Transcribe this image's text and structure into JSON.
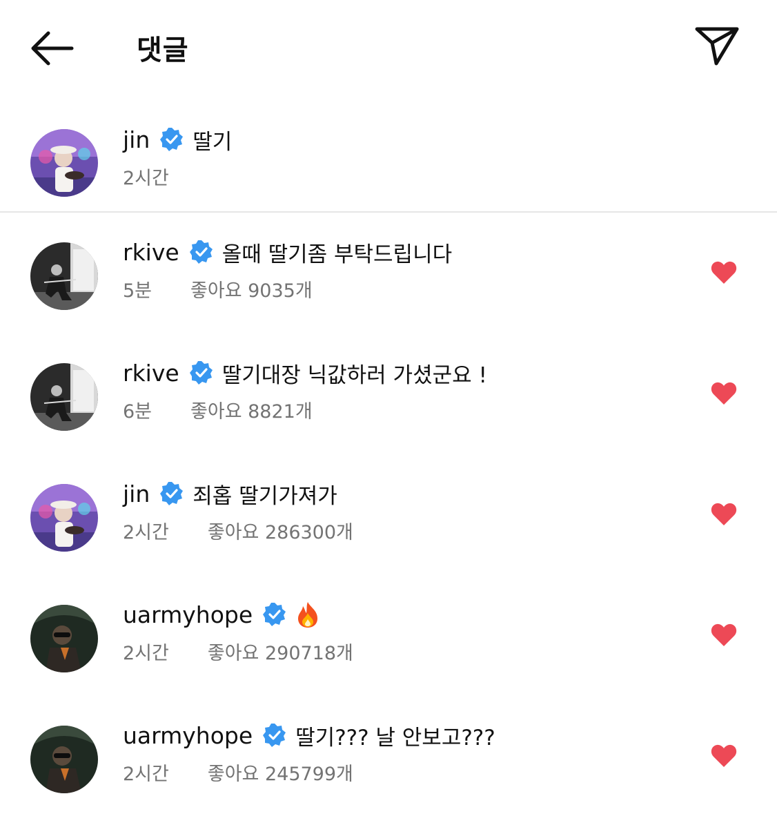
{
  "header": {
    "title": "댓글",
    "back_icon": "arrow-left-icon",
    "send_icon": "send-icon"
  },
  "caption": {
    "username": "jin",
    "text": "딸기",
    "time": "2시간"
  },
  "colors": {
    "verified": "#3897f0",
    "heart": "#ed4956",
    "secondary_text": "#737373",
    "divider": "#e6e6e6"
  },
  "comments": [
    {
      "username": "rkive",
      "text": "올때 딸기좀 부탁드립니다",
      "time": "5분",
      "likes": "좋아요 9035개",
      "avatar": "rkive"
    },
    {
      "username": "rkive",
      "text": "딸기대장 닉값하러 가셨군요 !",
      "time": "6분",
      "likes": "좋아요 8821개",
      "avatar": "rkive"
    },
    {
      "username": "jin",
      "text": "죄홉 딸기가져가",
      "time": "2시간",
      "likes": "좋아요 286300개",
      "avatar": "jin"
    },
    {
      "username": "uarmyhope",
      "text": "",
      "emoji": "fire-emoji",
      "time": "2시간",
      "likes": "좋아요 290718개",
      "avatar": "uarmyhope"
    },
    {
      "username": "uarmyhope",
      "text": "딸기??? 날 안보고???",
      "time": "2시간",
      "likes": "좋아요 245799개",
      "avatar": "uarmyhope"
    }
  ]
}
